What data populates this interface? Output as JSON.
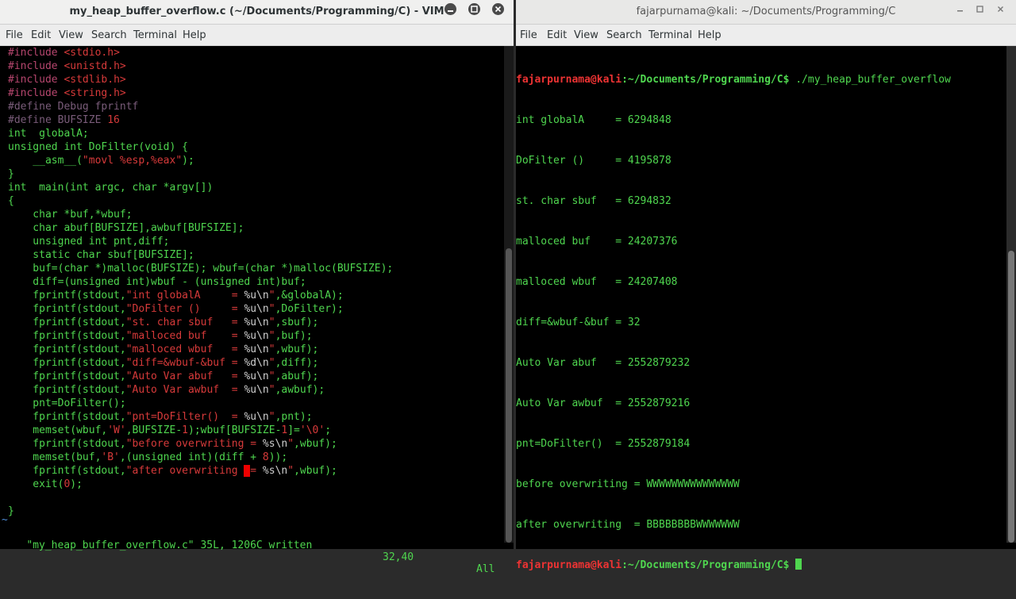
{
  "vim": {
    "title": "my_heap_buffer_overflow.c (~/Documents/Programming/C) - VIM",
    "menu": [
      "File",
      "Edit",
      "View",
      "Search",
      "Terminal",
      "Help"
    ],
    "lines": [
      [
        [
          "pp",
          "#include "
        ],
        [
          "str",
          "<stdio.h>"
        ]
      ],
      [
        [
          "pp",
          "#include "
        ],
        [
          "str",
          "<unistd.h>"
        ]
      ],
      [
        [
          "pp",
          "#include "
        ],
        [
          "str",
          "<stdlib.h>"
        ]
      ],
      [
        [
          "pp",
          "#include "
        ],
        [
          "str",
          "<string.h>"
        ]
      ],
      [
        [
          "cm",
          "#define Debug fprintf"
        ]
      ],
      [
        [
          "cm",
          "#define BUFSIZE "
        ],
        [
          "str",
          "16"
        ]
      ],
      [
        [
          "g",
          "int  globalA;"
        ]
      ],
      [
        [
          "g",
          "unsigned int DoFilter(void) {"
        ]
      ],
      [
        [
          "g",
          "    __asm__("
        ],
        [
          "str",
          "\"movl %esp,%eax\""
        ],
        [
          "g",
          ");"
        ]
      ],
      [
        [
          "g",
          "}"
        ]
      ],
      [
        [
          "g",
          "int  main(int argc, char *argv[])"
        ]
      ],
      [
        [
          "g",
          "{"
        ]
      ],
      [
        [
          "g",
          "    char *buf,*wbuf;"
        ]
      ],
      [
        [
          "g",
          "    char abuf[BUFSIZE],awbuf[BUFSIZE];"
        ]
      ],
      [
        [
          "g",
          "    unsigned int pnt,diff;"
        ]
      ],
      [
        [
          "g",
          "    static char sbuf[BUFSIZE];"
        ]
      ],
      [
        [
          "g",
          "    buf=(char *)malloc(BUFSIZE); wbuf=(char *)malloc(BUFSIZE);"
        ]
      ],
      [
        [
          "g",
          "    diff=(unsigned int)wbuf - (unsigned int)buf;"
        ]
      ],
      [
        [
          "g",
          "    fprintf(stdout,"
        ],
        [
          "str",
          "\"int globalA     = "
        ],
        [
          "w",
          "%u\\n"
        ],
        [
          "str",
          "\""
        ],
        [
          "g",
          ",&globalA);"
        ]
      ],
      [
        [
          "g",
          "    fprintf(stdout,"
        ],
        [
          "str",
          "\"DoFilter ()     = "
        ],
        [
          "w",
          "%u\\n"
        ],
        [
          "str",
          "\""
        ],
        [
          "g",
          ",DoFilter);"
        ]
      ],
      [
        [
          "g",
          "    fprintf(stdout,"
        ],
        [
          "str",
          "\"st. char sbuf   = "
        ],
        [
          "w",
          "%u\\n"
        ],
        [
          "str",
          "\""
        ],
        [
          "g",
          ",sbuf);"
        ]
      ],
      [
        [
          "g",
          "    fprintf(stdout,"
        ],
        [
          "str",
          "\"malloced buf    = "
        ],
        [
          "w",
          "%u\\n"
        ],
        [
          "str",
          "\""
        ],
        [
          "g",
          ",buf);"
        ]
      ],
      [
        [
          "g",
          "    fprintf(stdout,"
        ],
        [
          "str",
          "\"malloced wbuf   = "
        ],
        [
          "w",
          "%u\\n"
        ],
        [
          "str",
          "\""
        ],
        [
          "g",
          ",wbuf);"
        ]
      ],
      [
        [
          "g",
          "    fprintf(stdout,"
        ],
        [
          "str",
          "\"diff=&wbuf-&buf = "
        ],
        [
          "w",
          "%d\\n"
        ],
        [
          "str",
          "\""
        ],
        [
          "g",
          ",diff);"
        ]
      ],
      [
        [
          "g",
          "    fprintf(stdout,"
        ],
        [
          "str",
          "\"Auto Var abuf   = "
        ],
        [
          "w",
          "%u\\n"
        ],
        [
          "str",
          "\""
        ],
        [
          "g",
          ",abuf);"
        ]
      ],
      [
        [
          "g",
          "    fprintf(stdout,"
        ],
        [
          "str",
          "\"Auto Var awbuf  = "
        ],
        [
          "w",
          "%u\\n"
        ],
        [
          "str",
          "\""
        ],
        [
          "g",
          ",awbuf);"
        ]
      ],
      [
        [
          "g",
          "    pnt=DoFilter();"
        ]
      ],
      [
        [
          "g",
          "    fprintf(stdout,"
        ],
        [
          "str",
          "\"pnt=DoFilter()  = "
        ],
        [
          "w",
          "%u\\n"
        ],
        [
          "str",
          "\""
        ],
        [
          "g",
          ",pnt);"
        ]
      ],
      [
        [
          "g",
          "    memset(wbuf,"
        ],
        [
          "str",
          "'W'"
        ],
        [
          "g",
          ",BUFSIZE-"
        ],
        [
          "str",
          "1"
        ],
        [
          "g",
          ");wbuf[BUFSIZE-"
        ],
        [
          "str",
          "1"
        ],
        [
          "g",
          "]="
        ],
        [
          "str",
          "'\\0'"
        ],
        [
          "g",
          ";"
        ]
      ],
      [
        [
          "g",
          "    fprintf(stdout,"
        ],
        [
          "str",
          "\"before overwriting = "
        ],
        [
          "w",
          "%s\\n"
        ],
        [
          "str",
          "\""
        ],
        [
          "g",
          ",wbuf);"
        ]
      ],
      [
        [
          "g",
          "    memset(buf,"
        ],
        [
          "str",
          "'B'"
        ],
        [
          "g",
          ",(unsigned int)(diff + "
        ],
        [
          "str",
          "8"
        ],
        [
          "g",
          "));"
        ]
      ],
      [
        [
          "g",
          "    fprintf(stdout,"
        ],
        [
          "str",
          "\"after overwriting "
        ],
        [
          "cur",
          "="
        ],
        [
          "str",
          "= "
        ],
        [
          "w",
          "%s\\n"
        ],
        [
          "str",
          "\""
        ],
        [
          "g",
          ",wbuf);"
        ]
      ],
      [
        [
          "g",
          "    exit("
        ],
        [
          "str",
          "0"
        ],
        [
          "g",
          ");"
        ]
      ],
      [
        [
          "g",
          ""
        ]
      ],
      [
        [
          "g",
          "}"
        ]
      ]
    ],
    "tilde": "~",
    "status_file": "\"my_heap_buffer_overflow.c\" 35L, 1206C written",
    "status_pos": "32,40",
    "status_all": "All"
  },
  "terminal": {
    "title": "fajarpurnama@kali: ~/Documents/Programming/C",
    "menu": [
      "File",
      "Edit",
      "View",
      "Search",
      "Terminal",
      "Help"
    ],
    "prompt_user": "fajarpurnama@kali",
    "prompt_path": ":~/Documents/Programming/C$",
    "command": " ./my_heap_buffer_overflow",
    "output": [
      "int globalA     = 6294848",
      "DoFilter ()     = 4195878",
      "st. char sbuf   = 6294832",
      "malloced buf    = 24207376",
      "malloced wbuf   = 24207408",
      "diff=&wbuf-&buf = 32",
      "Auto Var abuf   = 2552879232",
      "Auto Var awbuf  = 2552879216",
      "pnt=DoFilter()  = 2552879184",
      "before overwriting = WWWWWWWWWWWWWWW",
      "after overwriting  = BBBBBBBBWWWWWWW"
    ]
  }
}
